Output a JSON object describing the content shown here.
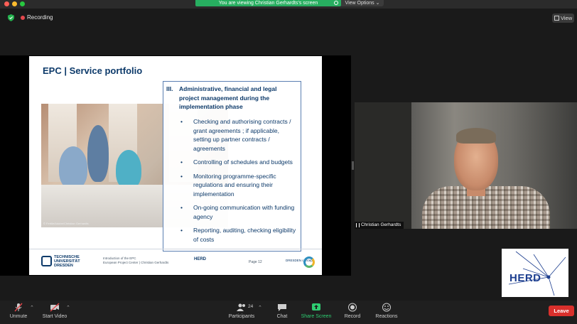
{
  "banner": {
    "viewing_text": "You are viewing Christian Gerhardts's screen",
    "view_options": "View Options ⌄"
  },
  "meeting": {
    "recording_label": "Recording",
    "view_label": "View"
  },
  "slide": {
    "title": "EPC | Service portfolio",
    "section_number": "III.",
    "section_heading": "Administrative, financial and legal project management during the implementation phase",
    "bullets": [
      "Checking and authorising contracts / grant agreements ; if applicable, setting up partner contracts / agreements",
      "Controlling of schedules and budgets",
      "Monitoring programme-specific regulations and ensuring their implementation",
      "On-going communication with funding agency",
      "Reporting, auditing, checking eligibility of costs"
    ],
    "photo_credit": "© Fertile/Adobe/Christian Gerhardts",
    "footer": {
      "university": "TECHNISCHE UNIVERSITÄT DRESDEN",
      "course_line1": "Introduction of the EPC",
      "course_line2": "European Project Center | Christian Gerhardts",
      "herd": "HERD",
      "page": "Page 12",
      "dresden": "DRESDEN concept"
    }
  },
  "participant": {
    "name": "Christian Gerhardts"
  },
  "logo": {
    "text": "HERD"
  },
  "toolbar": {
    "unmute": "Unmute",
    "start_video": "Start Video",
    "participants": "Participants",
    "participants_count": "24",
    "chat": "Chat",
    "share_screen": "Share Screen",
    "record": "Record",
    "reactions": "Reactions",
    "leave": "Leave"
  },
  "colors": {
    "share_green": "#27ae60",
    "recording_red": "#e5484d",
    "leave_red": "#d9302c",
    "slide_navy": "#0d3a6a"
  }
}
